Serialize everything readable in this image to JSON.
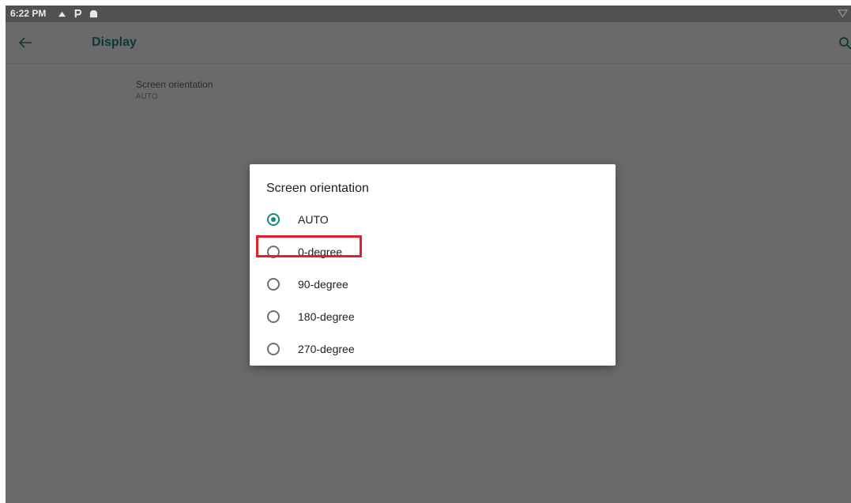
{
  "status_bar": {
    "time": "6:22 PM",
    "icons": [
      "notification-icon",
      "parking-app-icon",
      "android-icon"
    ],
    "right_icon": "wifi-icon"
  },
  "toolbar": {
    "back_icon": "back-arrow-icon",
    "title": "Display",
    "search_icon": "search-icon"
  },
  "preference": {
    "title": "Screen orientation",
    "summary": "AUTO"
  },
  "dialog": {
    "title": "Screen orientation",
    "options": [
      {
        "label": "AUTO",
        "checked": true
      },
      {
        "label": "0-degree",
        "checked": false
      },
      {
        "label": "90-degree",
        "checked": false
      },
      {
        "label": "180-degree",
        "checked": false
      },
      {
        "label": "270-degree",
        "checked": false
      }
    ],
    "highlighted_option": "0-degree"
  },
  "colors": {
    "accent": "#148a7e",
    "highlight": "#e0202a",
    "scrim": "#6a6a6a"
  }
}
